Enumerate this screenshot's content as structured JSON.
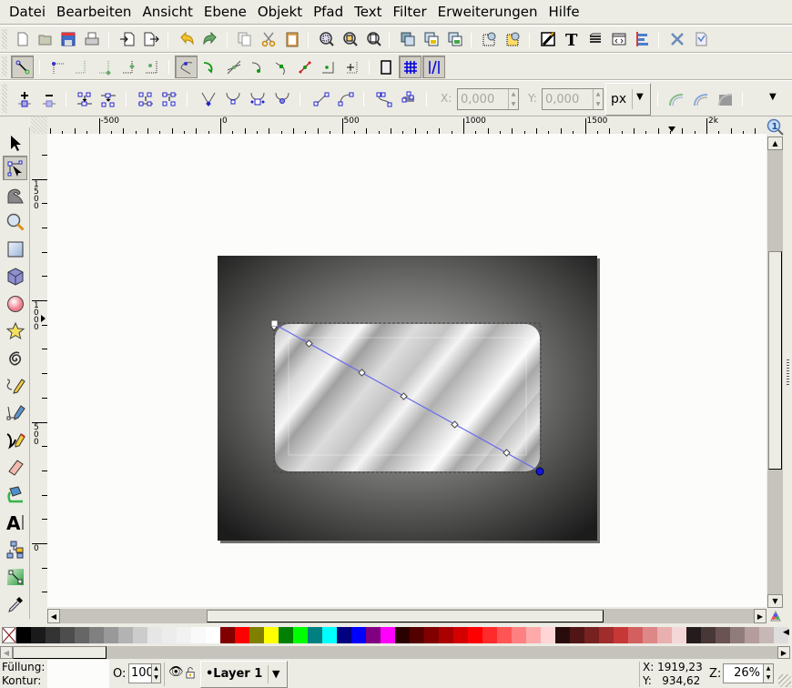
{
  "menu": [
    "Datei",
    "Bearbeiten",
    "Ansicht",
    "Ebene",
    "Objekt",
    "Pfad",
    "Text",
    "Filter",
    "Erweiterungen",
    "Hilfe"
  ],
  "commands_toolbar": [
    "new-document",
    "open",
    "save",
    "print",
    "import",
    "export",
    "undo",
    "redo",
    "duplicate",
    "cut",
    "paste",
    "zoom-selection",
    "zoom-drawing",
    "zoom-page",
    "group",
    "lock",
    "unlock",
    "select-all-in-layer",
    "deselect",
    "fill-and-stroke",
    "text-and-font",
    "layers",
    "xml-editor",
    "align-and-distribute",
    "preferences",
    "document-properties"
  ],
  "snap_toolbar": {
    "items": [
      "snap-toggle",
      "snap-bbox",
      "snap-bbox-edges",
      "snap-bbox-corners",
      "snap-bbox-midpoints",
      "snap-bbox-center",
      "snap-nodes",
      "snap-paths",
      "snap-intersections",
      "snap-smooth-nodes",
      "snap-cusp-nodes",
      "snap-midpoints",
      "snap-object-center",
      "snap-rotation-center",
      "snap-page-border",
      "snap-grid",
      "snap-guides"
    ]
  },
  "node_toolbar": {
    "items": [
      "insert-node",
      "delete-node",
      "join-nodes",
      "break-path",
      "join-segment",
      "delete-segment",
      "make-cusp",
      "make-smooth",
      "make-symmetric",
      "make-auto-smooth",
      "make-line",
      "make-curve",
      "object-to-path",
      "stroke-to-path",
      "next-path-effect",
      "clippath-edit",
      "mask-edit",
      "more"
    ],
    "x_label": "X:",
    "x_value": "0,000",
    "y_label": "Y:",
    "y_value": "0,000",
    "unit": "px"
  },
  "ruler_top": {
    "labels": [
      "-500",
      "0",
      "500",
      "1000",
      "1500",
      "2k"
    ]
  },
  "ruler_left": {
    "labels": [
      "1500",
      "1000",
      "500",
      "0"
    ]
  },
  "tools": [
    "selector",
    "node-editor",
    "tweak",
    "zoom",
    "rectangle",
    "3d-box",
    "ellipse",
    "star",
    "spiral",
    "pencil",
    "pen",
    "calligraphy",
    "eraser",
    "paint-bucket",
    "text",
    "connector",
    "gradient",
    "dropper"
  ],
  "palette": {
    "colors": [
      "#000000",
      "#1a1a1a",
      "#333333",
      "#4d4d4d",
      "#666666",
      "#808080",
      "#999999",
      "#b3b3b3",
      "#cccccc",
      "#e6e6e6",
      "#ececec",
      "#f2f2f2",
      "#f9f9f9",
      "#ffffff",
      "#800000",
      "#ff0000",
      "#808000",
      "#ffff00",
      "#008000",
      "#00ff00",
      "#008080",
      "#00ffff",
      "#000080",
      "#0000ff",
      "#800080",
      "#ff00ff",
      "#2b0000",
      "#550000",
      "#800000",
      "#aa0000",
      "#d40000",
      "#ff0000",
      "#ff2a2a",
      "#ff5555",
      "#ff8080",
      "#ffaaaa",
      "#ffd5d5",
      "#280b0b",
      "#501616",
      "#782121",
      "#a02c2c",
      "#c83737",
      "#d35f5f",
      "#de8787",
      "#e9afaf",
      "#f4d7d7",
      "#241c1c",
      "#483737",
      "#6c5353",
      "#917c7c",
      "#b59d9d",
      "#c8b7b7",
      "#dddddd"
    ]
  },
  "status": {
    "fill_label": "Füllung:",
    "stroke_label": "Kontur:",
    "opacity_label": "O:",
    "opacity_value": "100",
    "layer_name": "•Layer 1",
    "x_coord": "X: 1919,23",
    "y_coord": "Y:   934,62",
    "zoom_label": "Z:",
    "zoom_value": "26%"
  }
}
